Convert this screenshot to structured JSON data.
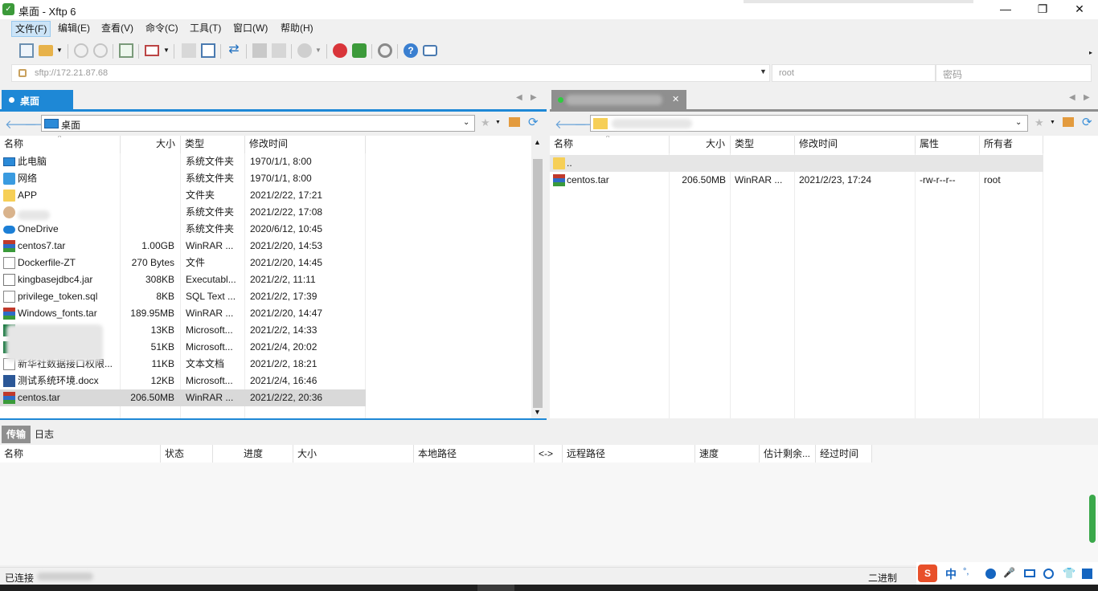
{
  "window": {
    "title": "桌面 - Xftp 6",
    "app_icon": "xftp-icon"
  },
  "menu": [
    {
      "label": "文件(F)"
    },
    {
      "label": "编辑(E)"
    },
    {
      "label": "查看(V)"
    },
    {
      "label": "命令(C)"
    },
    {
      "label": "工具(T)"
    },
    {
      "label": "窗口(W)"
    },
    {
      "label": "帮助(H)"
    }
  ],
  "address": {
    "url": "sftp://172.21.87.68",
    "user": "root",
    "password_placeholder": "密码"
  },
  "local": {
    "tab_label": "桌面",
    "path": "桌面",
    "columns": {
      "name": "名称",
      "size": "大小",
      "type": "类型",
      "modified": "修改时间"
    },
    "files": [
      {
        "name": "此电脑",
        "size": "",
        "type": "系统文件夹",
        "modified": "1970/1/1, 8:00",
        "icon": "pc-icon"
      },
      {
        "name": "网络",
        "size": "",
        "type": "系统文件夹",
        "modified": "1970/1/1, 8:00",
        "icon": "network-icon"
      },
      {
        "name": "APP",
        "size": "",
        "type": "文件夹",
        "modified": "2021/2/22, 17:21",
        "icon": "folder-icon"
      },
      {
        "name": "",
        "size": "",
        "type": "系统文件夹",
        "modified": "2021/2/22, 17:08",
        "icon": "user-icon"
      },
      {
        "name": "OneDrive",
        "size": "",
        "type": "系统文件夹",
        "modified": "2020/6/12, 10:45",
        "icon": "cloud-icon"
      },
      {
        "name": "centos7.tar",
        "size": "1.00GB",
        "type": "WinRAR ...",
        "modified": "2021/2/20, 14:53",
        "icon": "rar-icon"
      },
      {
        "name": "Dockerfile-ZT",
        "size": "270 Bytes",
        "type": "文件",
        "modified": "2021/2/20, 14:45",
        "icon": "file-icon"
      },
      {
        "name": "kingbasejdbc4.jar",
        "size": "308KB",
        "type": "Executabl...",
        "modified": "2021/2/2, 11:11",
        "icon": "jar-icon"
      },
      {
        "name": "privilege_token.sql",
        "size": "8KB",
        "type": "SQL Text ...",
        "modified": "2021/2/2, 17:39",
        "icon": "file-icon"
      },
      {
        "name": "Windows_fonts.tar",
        "size": "189.95MB",
        "type": "WinRAR ...",
        "modified": "2021/2/20, 14:47",
        "icon": "rar-icon"
      },
      {
        "name": "",
        "size": "13KB",
        "type": "Microsoft...",
        "modified": "2021/2/2, 14:33",
        "icon": "excel-icon"
      },
      {
        "name": "sx",
        "size": "51KB",
        "type": "Microsoft...",
        "modified": "2021/2/4, 20:02",
        "icon": "excel-icon"
      },
      {
        "name": "新华社数据接口权限...",
        "size": "11KB",
        "type": "文本文档",
        "modified": "2021/2/2, 18:21",
        "icon": "file-icon"
      },
      {
        "name": "测试系统环境.docx",
        "size": "12KB",
        "type": "Microsoft...",
        "modified": "2021/2/4, 16:46",
        "icon": "word-icon"
      },
      {
        "name": "centos.tar",
        "size": "206.50MB",
        "type": "WinRAR ...",
        "modified": "2021/2/22, 20:36",
        "icon": "rar-icon",
        "selected": true
      }
    ]
  },
  "remote": {
    "columns": {
      "name": "名称",
      "size": "大小",
      "type": "类型",
      "modified": "修改时间",
      "attr": "属性",
      "owner": "所有者"
    },
    "files": [
      {
        "name": "..",
        "size": "",
        "type": "",
        "modified": "",
        "attr": "",
        "owner": "",
        "icon": "folder-icon",
        "selected": true
      },
      {
        "name": "centos.tar",
        "size": "206.50MB",
        "type": "WinRAR ...",
        "modified": "2021/2/23, 17:24",
        "attr": "-rw-r--r--",
        "owner": "root",
        "icon": "rar-icon"
      }
    ]
  },
  "bottom": {
    "tabs": [
      {
        "label": "传输"
      },
      {
        "label": "日志"
      }
    ],
    "columns": [
      "名称",
      "状态",
      "进度",
      "大小",
      "本地路径",
      "<->",
      "远程路径",
      "速度",
      "估计剩余...",
      "经过时间"
    ]
  },
  "status": {
    "left": "已连接",
    "mode": "二进制"
  },
  "ime": {
    "label": "中"
  }
}
